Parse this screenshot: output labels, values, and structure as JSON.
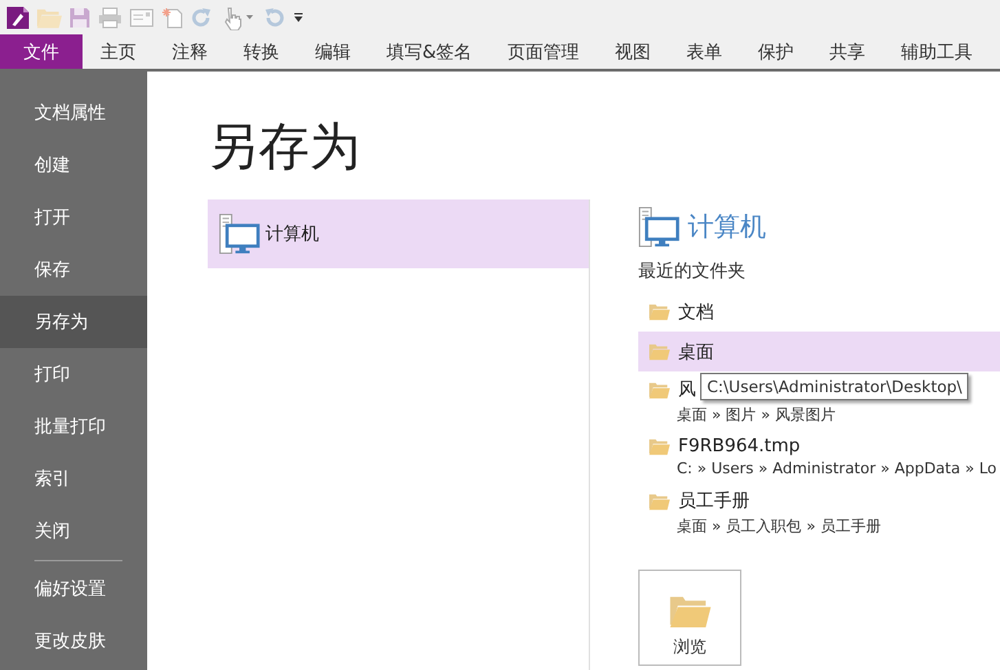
{
  "tabs": [
    {
      "label": "文件",
      "selected": true
    },
    {
      "label": "主页",
      "selected": false
    },
    {
      "label": "注释",
      "selected": false
    },
    {
      "label": "转换",
      "selected": false
    },
    {
      "label": "编辑",
      "selected": false
    },
    {
      "label": "填写&签名",
      "selected": false
    },
    {
      "label": "页面管理",
      "selected": false
    },
    {
      "label": "视图",
      "selected": false
    },
    {
      "label": "表单",
      "selected": false
    },
    {
      "label": "保护",
      "selected": false
    },
    {
      "label": "共享",
      "selected": false
    },
    {
      "label": "辅助工具",
      "selected": false
    }
  ],
  "sidebar": {
    "items": [
      {
        "label": "文档属性",
        "selected": false
      },
      {
        "label": "创建",
        "selected": false
      },
      {
        "label": "打开",
        "selected": false
      },
      {
        "label": "保存",
        "selected": false
      },
      {
        "label": "另存为",
        "selected": true
      },
      {
        "label": "打印",
        "selected": false
      },
      {
        "label": "批量打印",
        "selected": false
      },
      {
        "label": "索引",
        "selected": false
      },
      {
        "label": "关闭",
        "selected": false
      }
    ],
    "bottom_items": [
      {
        "label": "偏好设置",
        "selected": false
      },
      {
        "label": "更改皮肤",
        "selected": false
      }
    ]
  },
  "title": "另存为",
  "places": [
    {
      "label": "计算机",
      "selected": true
    }
  ],
  "detail": {
    "heading": "计算机",
    "recent_label": "最近的文件夹",
    "folders": [
      {
        "name": "文档",
        "selected": false
      },
      {
        "name": "桌面",
        "selected": true
      },
      {
        "name": "风",
        "path": "桌面 » 图片 » 风景图片",
        "selected": false
      },
      {
        "name": "F9RB964.tmp",
        "path": "C: » Users » Administrator » AppData » Lo",
        "selected": false
      },
      {
        "name": "员工手册",
        "path": "桌面 » 员工入职包 » 员工手册",
        "selected": false
      }
    ],
    "tooltip": "C:\\Users\\Administrator\\Desktop\\",
    "browse_label": "浏览"
  }
}
